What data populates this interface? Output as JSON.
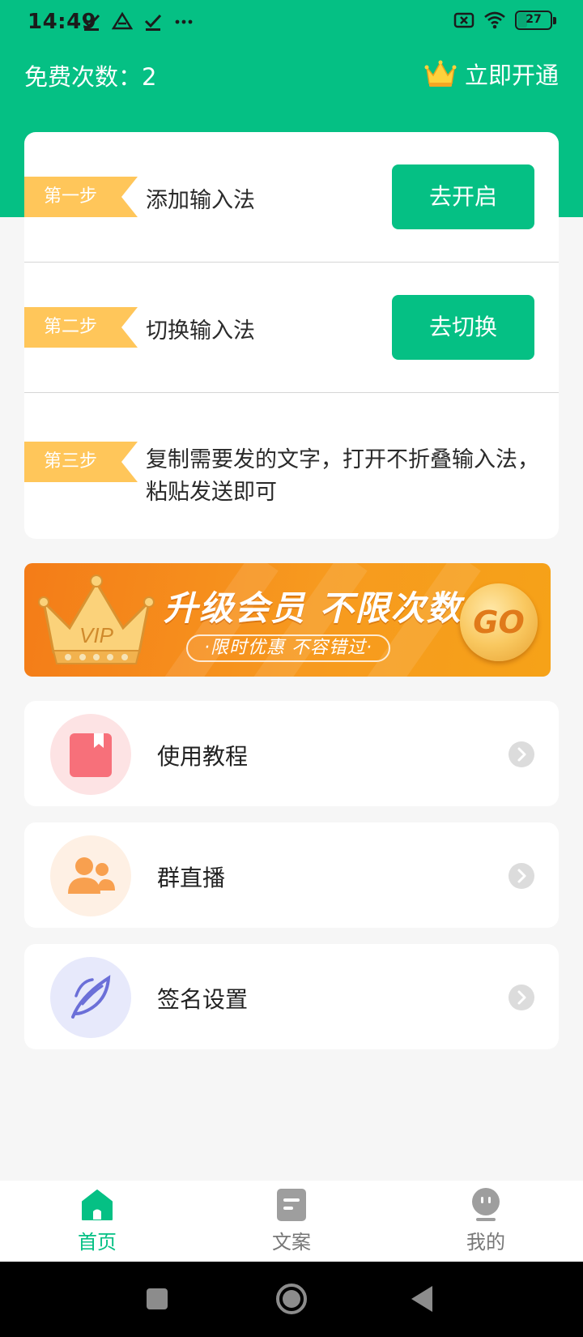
{
  "status_bar": {
    "time": "14:49",
    "battery": "27"
  },
  "header": {
    "free_count": "免费次数：2",
    "vip_open": "立即开通"
  },
  "steps": [
    {
      "tag": "第一步",
      "text": "添加输入法",
      "button": "去开启"
    },
    {
      "tag": "第二步",
      "text": "切换输入法",
      "button": "去切换"
    },
    {
      "tag": "第三步",
      "text_line1": "复制需要发的文字，打开不折叠输入法，",
      "text_line2": "粘贴发送即可"
    }
  ],
  "banner": {
    "crown_text": "VIP",
    "title": "升级会员 不限次数",
    "subtitle": "·限时优惠  不容错过·",
    "go": "GO"
  },
  "menu": [
    {
      "label": "使用教程",
      "icon": "book-icon",
      "color": "#f7707a"
    },
    {
      "label": "群直播",
      "icon": "users-icon",
      "color": "#f8a04f"
    },
    {
      "label": "签名设置",
      "icon": "feather-icon",
      "color": "#6b6fd8"
    }
  ],
  "tabs": [
    {
      "label": "首页",
      "icon": "home-icon",
      "active": true
    },
    {
      "label": "文案",
      "icon": "document-icon",
      "active": false
    },
    {
      "label": "我的",
      "icon": "profile-icon",
      "active": false
    }
  ],
  "colors": {
    "brand": "#05c084",
    "step_tag": "#ffc65a"
  }
}
